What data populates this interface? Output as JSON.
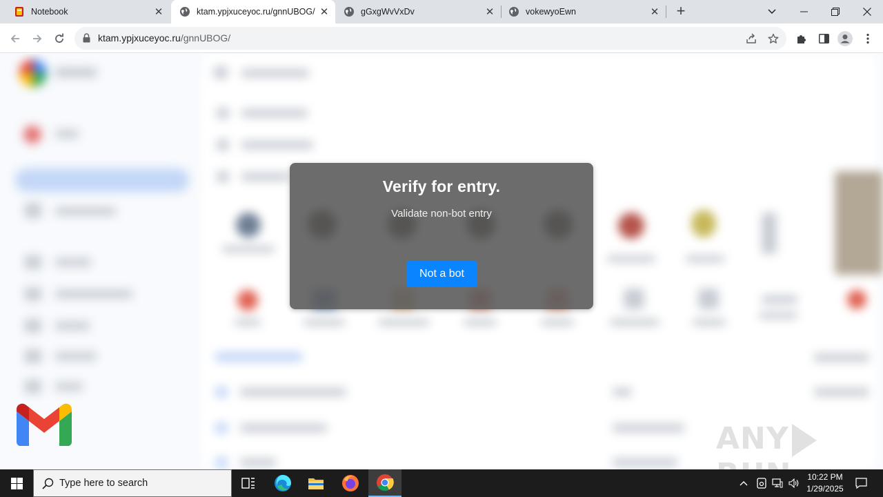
{
  "browser": {
    "tabs": [
      {
        "title": "Notebook",
        "active": false
      },
      {
        "title": "ktam.ypjxuceyoc.ru/gnnUBOG/",
        "active": true
      },
      {
        "title": "gGxgWvVxDv",
        "active": false
      },
      {
        "title": "vokewyoEwn",
        "active": false
      }
    ],
    "url_host": "ktam.ypjxuceyoc.ru",
    "url_path": "/gnnUBOG/"
  },
  "modal": {
    "title": "Verify for entry.",
    "subtitle": "Validate non-bot entry",
    "button_label": "Not a bot"
  },
  "watermark": {
    "left": "ANY",
    "right": "RUN"
  },
  "taskbar": {
    "search_placeholder": "Type here to search",
    "time": "10:22 PM",
    "date": "1/29/2025"
  },
  "colors": {
    "button": "#0a84ff",
    "modal_bg": "#585858",
    "taskbar_bg": "#1c1c1c",
    "tabbar_bg": "#dee1e6"
  }
}
